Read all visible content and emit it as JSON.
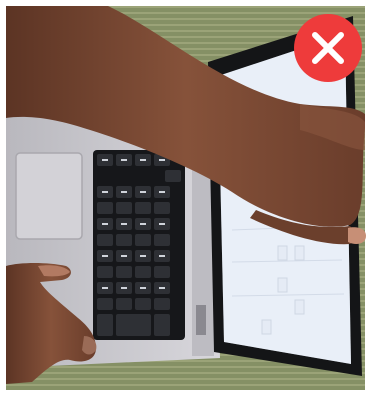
{
  "photo": {
    "subject": "hands-on-laptop-photo",
    "badge_icon": "close-x-icon",
    "colors": {
      "badge": "#ee3b3b",
      "badge_mark": "#ffffff",
      "mat": "#8f9a6e",
      "laptop_body": "#c9c8ce",
      "keyboard": "#17181b",
      "screen": "#eef3fb",
      "skin": "#7a4b34"
    }
  }
}
